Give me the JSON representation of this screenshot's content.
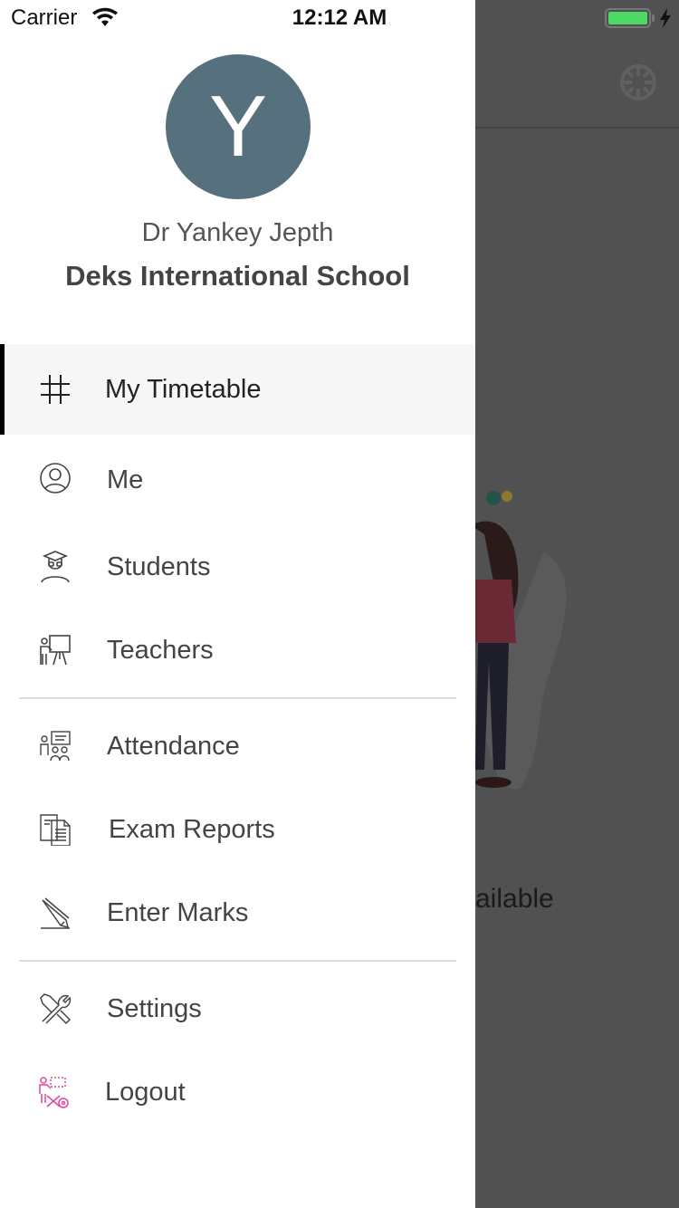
{
  "status_bar": {
    "carrier": "Carrier",
    "time": "12:12 AM"
  },
  "background": {
    "text": "ailable"
  },
  "drawer": {
    "avatar_letter": "Y",
    "user_name": "Dr Yankey Jepth",
    "school_name": "Deks International School",
    "menu": [
      {
        "label": "My Timetable",
        "icon": "grid-icon",
        "active": true
      },
      {
        "label": "Me",
        "icon": "user-icon"
      },
      {
        "label": "Students",
        "icon": "student-icon"
      },
      {
        "label": "Teachers",
        "icon": "teacher-icon"
      },
      {
        "label": "Attendance",
        "icon": "attendance-icon"
      },
      {
        "label": "Exam Reports",
        "icon": "report-icon"
      },
      {
        "label": "Enter Marks",
        "icon": "pencil-icon"
      },
      {
        "label": "Settings",
        "icon": "tools-icon"
      },
      {
        "label": "Logout",
        "icon": "logout-icon"
      }
    ]
  },
  "colors": {
    "avatar": "#56717d",
    "logout_icon": "#e0459a",
    "battery": "#4cd964"
  }
}
